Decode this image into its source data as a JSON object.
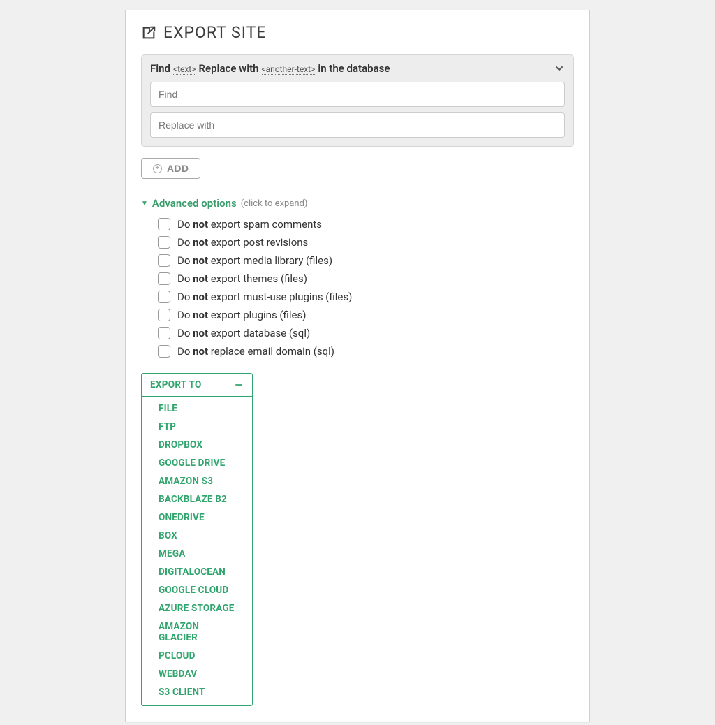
{
  "title": "EXPORT SITE",
  "findReplace": {
    "headerParts": {
      "p1": "Find",
      "t1": "<text>",
      "p2": "Replace with",
      "t2": "<another-text>",
      "p3": "in the database"
    },
    "findPlaceholder": "Find",
    "replacePlaceholder": "Replace with"
  },
  "addButton": {
    "label": "ADD"
  },
  "advanced": {
    "label": "Advanced options",
    "hint": "(click to expand)",
    "options": [
      {
        "pre": "Do ",
        "bold": "not",
        "post": " export spam comments"
      },
      {
        "pre": "Do ",
        "bold": "not",
        "post": " export post revisions"
      },
      {
        "pre": "Do ",
        "bold": "not",
        "post": " export media library (files)"
      },
      {
        "pre": "Do ",
        "bold": "not",
        "post": " export themes (files)"
      },
      {
        "pre": "Do ",
        "bold": "not",
        "post": " export must-use plugins (files)"
      },
      {
        "pre": "Do ",
        "bold": "not",
        "post": " export plugins (files)"
      },
      {
        "pre": "Do ",
        "bold": "not",
        "post": " export database (sql)"
      },
      {
        "pre": "Do ",
        "bold": "not",
        "post": " replace email domain (sql)"
      }
    ]
  },
  "exportTo": {
    "label": "EXPORT TO",
    "items": [
      "FILE",
      "FTP",
      "DROPBOX",
      "GOOGLE DRIVE",
      "AMAZON S3",
      "BACKBLAZE B2",
      "ONEDRIVE",
      "BOX",
      "MEGA",
      "DIGITALOCEAN",
      "GOOGLE CLOUD",
      "AZURE STORAGE",
      "AMAZON GLACIER",
      "PCLOUD",
      "WEBDAV",
      "S3 CLIENT"
    ]
  },
  "colors": {
    "accent": "#31a56e"
  }
}
